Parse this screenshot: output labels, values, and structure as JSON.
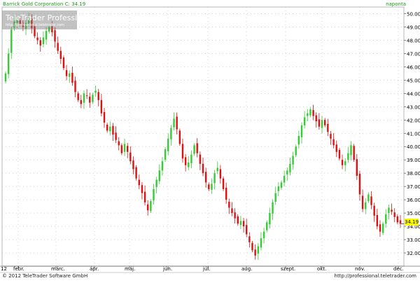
{
  "header": {
    "title": "Barrick Gold Corporation C: 34.19",
    "period": "naponta"
  },
  "watermark": {
    "name": "TeleTrader Professional",
    "url": "http://professional.teletrader.com"
  },
  "footer": {
    "copyright": "© 2012 TeleTrader Software GmbH",
    "url": "http://professional.teletrader.com"
  },
  "last_price_label": "34.19",
  "colors": {
    "up": "#33cc33",
    "down": "#dd1111",
    "grid": "#b8b8b8",
    "header_text": "#1a9a1a",
    "last_price_bg": "#ffff00"
  },
  "chart_data": {
    "type": "candlestick",
    "title": "Barrick Gold Corporation C: 34.19",
    "period": "naponta",
    "ylim": [
      31.0,
      50.5
    ],
    "yticks": [
      32,
      33,
      34,
      35,
      36,
      37,
      38,
      39,
      40,
      41,
      42,
      43,
      44,
      45,
      46,
      47,
      48,
      49,
      50
    ],
    "ytick_labels": [
      "32.00",
      "33.00",
      "34.00",
      "35.00",
      "36.00",
      "37.00",
      "38.00",
      "39.00",
      "40.00",
      "41.00",
      "42.00",
      "43.00",
      "44.00",
      "45.00",
      "46.00",
      "47.00",
      "48.00",
      "49.00",
      "50.00"
    ],
    "x_start_label": "12",
    "x_month_labels": [
      "febr.",
      "márc.",
      "ápr.",
      "máj.",
      "jún.",
      "júl.",
      "aug.",
      "szept.",
      "okt.",
      "nov.",
      "dec."
    ],
    "last_value": 34.19,
    "grid": true,
    "series": [
      {
        "values": [
          45.5,
          47.0,
          48.8,
          49.4,
          49.5,
          49.2,
          49.0,
          49.3,
          49.6,
          48.9,
          48.3,
          48.0,
          47.6,
          48.2,
          48.7,
          49.0,
          48.6,
          47.9,
          47.2,
          46.6,
          45.9,
          45.3,
          45.5,
          44.8,
          44.1,
          43.5,
          43.2,
          44.0,
          43.8,
          43.3,
          43.9,
          44.2,
          43.5,
          42.5,
          41.8,
          41.2,
          41.5,
          40.9,
          40.5,
          40.1,
          39.5,
          40.2,
          39.6,
          38.9,
          38.3,
          37.6,
          37.1,
          36.5,
          35.8,
          35.2,
          35.9,
          36.8,
          37.5,
          38.2,
          38.9,
          39.8,
          40.6,
          41.4,
          42.1,
          41.3,
          40.2,
          39.1,
          38.6,
          38.8,
          39.4,
          40.1,
          39.5,
          38.7,
          38.0,
          37.3,
          36.8,
          37.2,
          38.0,
          38.4,
          37.6,
          36.8,
          36.0,
          35.4,
          35.0,
          34.6,
          34.2,
          34.4,
          34.0,
          33.4,
          32.8,
          32.2,
          31.8,
          32.5,
          33.1,
          33.6,
          34.3,
          35.0,
          35.8,
          36.5,
          37.0,
          37.3,
          37.8,
          38.2,
          38.7,
          39.3,
          40.0,
          40.8,
          41.6,
          42.2,
          42.5,
          42.8,
          42.3,
          41.9,
          41.5,
          42.0,
          41.6,
          41.1,
          40.6,
          40.1,
          39.6,
          39.1,
          38.6,
          38.9,
          39.5,
          40.1,
          39.0,
          37.8,
          36.4,
          35.3,
          35.8,
          36.4,
          35.6,
          34.8,
          34.0,
          33.6,
          34.2,
          34.9,
          35.4,
          35.1,
          34.7,
          34.3,
          34.19
        ]
      }
    ]
  }
}
